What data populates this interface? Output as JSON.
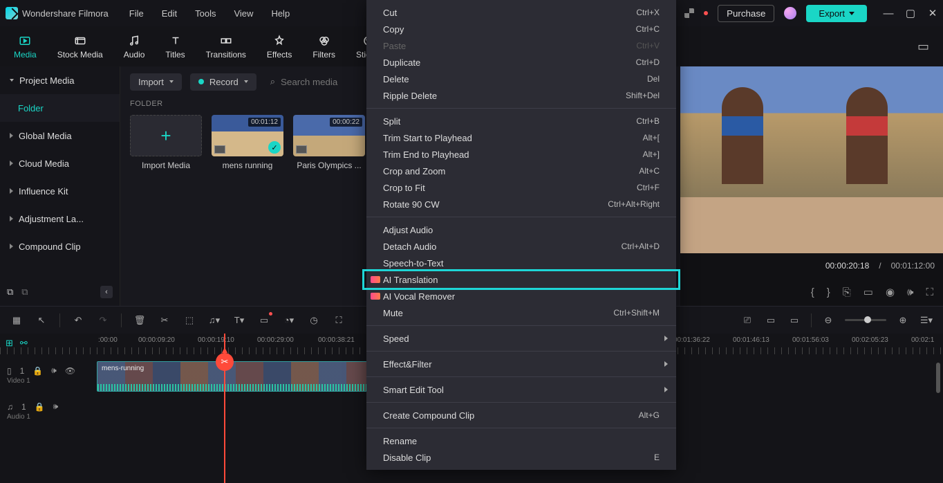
{
  "app": {
    "name": "Wondershare Filmora"
  },
  "menu": {
    "file": "File",
    "edit": "Edit",
    "tools": "Tools",
    "view": "View",
    "help": "Help"
  },
  "titlebar": {
    "purchase": "Purchase",
    "export": "Export"
  },
  "tabs": {
    "media": "Media",
    "stock": "Stock Media",
    "audio": "Audio",
    "titles": "Titles",
    "transitions": "Transitions",
    "effects": "Effects",
    "filters": "Filters",
    "stickers": "Sticker"
  },
  "sidebar": {
    "project": "Project Media",
    "folder": "Folder",
    "global": "Global Media",
    "cloud": "Cloud Media",
    "influence": "Influence Kit",
    "adjust": "Adjustment La...",
    "compound": "Compound Clip"
  },
  "mediapane": {
    "import": "Import",
    "record": "Record",
    "search_ph": "Search media",
    "folder_label": "FOLDER",
    "import_media": "Import Media",
    "clip1_name": "mens running",
    "clip1_dur": "00:01:12",
    "clip2_name": "Paris Olympics ...",
    "clip2_dur": "00:00:22"
  },
  "preview": {
    "current": "00:00:20:18",
    "sep": "/",
    "total": "00:01:12:00"
  },
  "timeline": {
    "marks": [
      ":00:00",
      "00:00:09:20",
      "00:00:19:10",
      "00:00:29:00",
      "00:00:38:21",
      "00:01:36:22",
      "00:01:46:13",
      "00:01:56:03",
      "00:02:05:23",
      "00:02:1"
    ],
    "mark_pos": [
      142,
      200,
      286,
      372,
      460,
      974,
      1060,
      1146,
      1232,
      1318
    ],
    "video_track": "Video 1",
    "audio_track": "Audio 1",
    "clip_name": "mens-running"
  },
  "context": {
    "items": [
      {
        "label": "Cut",
        "sc": "Ctrl+X"
      },
      {
        "label": "Copy",
        "sc": "Ctrl+C"
      },
      {
        "label": "Paste",
        "sc": "Ctrl+V",
        "disabled": true
      },
      {
        "label": "Duplicate",
        "sc": "Ctrl+D"
      },
      {
        "label": "Delete",
        "sc": "Del"
      },
      {
        "label": "Ripple Delete",
        "sc": "Shift+Del"
      },
      {
        "sep": true
      },
      {
        "label": "Split",
        "sc": "Ctrl+B"
      },
      {
        "label": "Trim Start to Playhead",
        "sc": "Alt+["
      },
      {
        "label": "Trim End to Playhead",
        "sc": "Alt+]"
      },
      {
        "label": "Crop and Zoom",
        "sc": "Alt+C"
      },
      {
        "label": "Crop to Fit",
        "sc": "Ctrl+F"
      },
      {
        "label": "Rotate 90 CW",
        "sc": "Ctrl+Alt+Right"
      },
      {
        "sep": true
      },
      {
        "label": "Adjust Audio"
      },
      {
        "label": "Detach Audio",
        "sc": "Ctrl+Alt+D"
      },
      {
        "label": "Speech-to-Text"
      },
      {
        "label": "AI Translation",
        "badge": true,
        "hl": true
      },
      {
        "label": "AI Vocal Remover",
        "badge": true
      },
      {
        "label": "Mute",
        "sc": "Ctrl+Shift+M"
      },
      {
        "sep": true
      },
      {
        "label": "Speed",
        "arrow": true
      },
      {
        "sep": true
      },
      {
        "label": "Effect&Filter",
        "arrow": true
      },
      {
        "sep": true
      },
      {
        "label": "Smart Edit Tool",
        "arrow": true
      },
      {
        "sep": true
      },
      {
        "label": "Create Compound Clip",
        "sc": "Alt+G"
      },
      {
        "sep": true
      },
      {
        "label": "Rename"
      },
      {
        "label": "Disable Clip",
        "sc": "E"
      }
    ]
  }
}
